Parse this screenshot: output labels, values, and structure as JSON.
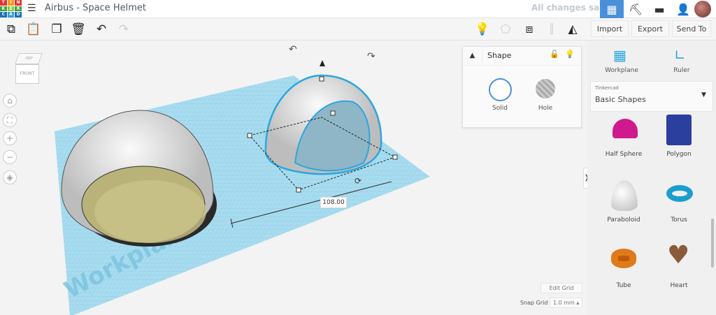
{
  "header": {
    "logo": [
      "T",
      "I",
      "N",
      "K",
      "E",
      "R",
      "C",
      "A",
      "D"
    ],
    "title": "Airbus - Space Helmet",
    "status": "All changes saved"
  },
  "toolbar": {
    "import": "Import",
    "export": "Export",
    "send_to": "Send To"
  },
  "viewcube": {
    "top": "TOP",
    "front": "FRONT"
  },
  "workplane_label": "Workplane",
  "dimension": "108.00",
  "shape_panel": {
    "title": "Shape",
    "solid": "Solid",
    "hole": "Hole"
  },
  "right_panel": {
    "workplane": "Workplane",
    "ruler": "Ruler",
    "library_source": "Tinkercad",
    "library": "Basic Shapes",
    "shapes": [
      {
        "name": "Half Sphere",
        "color": "#d0198c"
      },
      {
        "name": "Polygon",
        "color": "#2b3f9e"
      },
      {
        "name": "Paraboloid",
        "color": "#e8e8e8"
      },
      {
        "name": "Torus",
        "color": "#1a9ed0"
      },
      {
        "name": "Tube",
        "color": "#e07a1a"
      },
      {
        "name": "Heart",
        "color": "#8a5a3a"
      }
    ]
  },
  "grid": {
    "edit_grid": "Edit Grid",
    "snap_label": "Snap Grid",
    "snap_value": "1.0 mm"
  },
  "colors": {
    "accent": "#4a90d9",
    "workplane": "#8fd0ea"
  }
}
